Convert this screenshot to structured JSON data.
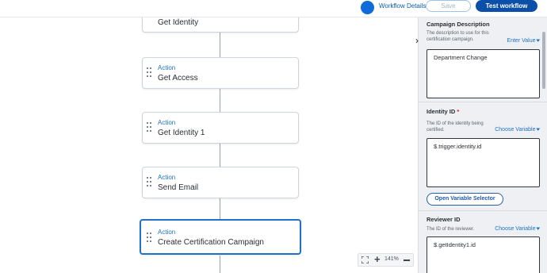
{
  "topbar": {
    "workflow_details_label": "Workflow Details",
    "save_label": "Save",
    "test_label": "Test workflow"
  },
  "canvas": {
    "nodes": [
      {
        "kind": "",
        "title": "Get Identity"
      },
      {
        "kind": "Action",
        "title": "Get Access"
      },
      {
        "kind": "Action",
        "title": "Get Identity 1"
      },
      {
        "kind": "Action",
        "title": "Send Email"
      },
      {
        "kind": "Action",
        "title": "Create Certification Campaign"
      }
    ],
    "zoom_level": "141%"
  },
  "panel": {
    "campaign_description": {
      "title": "Campaign Description",
      "description": "The description to use for this certification campaign.",
      "link": "Enter Value",
      "value": "Department Change"
    },
    "identity_id": {
      "title": "Identity ID",
      "required_marker": "*",
      "description": "The ID of the identity being certified.",
      "link": "Choose Variable",
      "value": "$.trigger.identity.id",
      "button": "Open Variable Selector"
    },
    "reviewer_id": {
      "title": "Reviewer ID",
      "description": "The ID of the reviewer.",
      "link": "Choose Variable",
      "value": "$.getIdentity1.id"
    }
  },
  "colors": {
    "accent": "#1f72c8",
    "primary_button": "#0b4fa8",
    "required": "#c8282d"
  },
  "icons": [
    "drag-handle-icon",
    "fit-view-icon",
    "zoom-in-icon",
    "zoom-out-icon",
    "chevron-right-icon",
    "chevron-down-icon"
  ]
}
